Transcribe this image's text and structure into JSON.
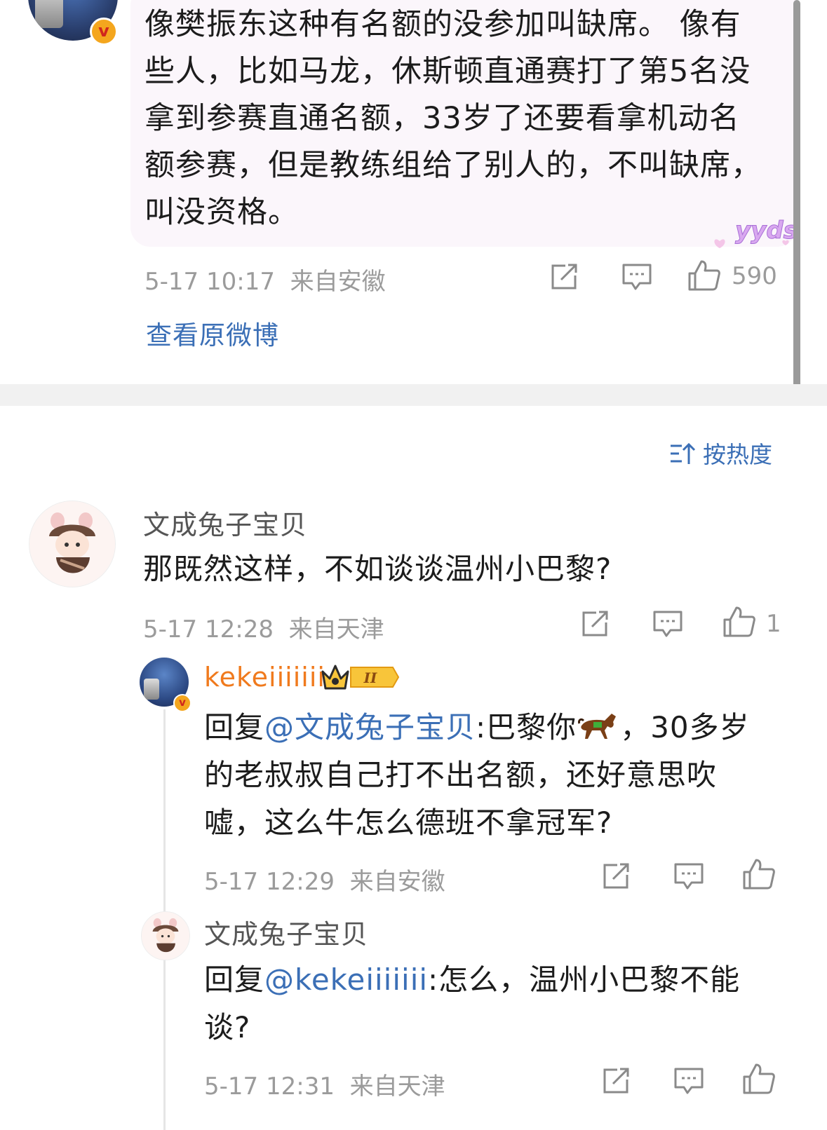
{
  "quoted_post": {
    "text": "像樊振东这种有名额的没参加叫缺席。 像有些人，比如马龙，休斯顿直通赛打了第5名没拿到参赛直通名额，33岁了还要看拿机动名额参赛，但是教练组给了别人的，不叫缺席，叫没资格。",
    "time": "5-17 10:17",
    "location": "来自安徽",
    "like_count": "590",
    "sticker_text": "yyds",
    "view_original_label": "查看原微博"
  },
  "sort": {
    "icon": "sort-icon",
    "label": "按热度"
  },
  "comments": [
    {
      "username": "文成兔子宝贝",
      "text": "那既然这样，不如谈谈温州小巴黎?",
      "time": "5-17 12:28",
      "location": "来自天津",
      "like_count": "1"
    }
  ],
  "replies": [
    {
      "username": "kekeiiiiiii",
      "badge_level": "II",
      "prefix": "回复",
      "mention": "@文成兔子宝贝",
      "text_before_emoji": ":巴黎你",
      "emoji": "horse-emoji",
      "text_after_emoji": "，30多岁的老叔叔自己打不出名额，还好意思吹嘘，这么牛怎么德班不拿冠军?",
      "time": "5-17 12:29",
      "location": "来自安徽"
    },
    {
      "username": "文成兔子宝贝",
      "prefix": "回复",
      "mention": "@kekeiiiiiii",
      "text": ":怎么，温州小巴黎不能谈?",
      "time": "5-17 12:31",
      "location": "来自天津"
    }
  ],
  "colors": {
    "link_blue": "#3b6fb6",
    "username_orange": "#f07a1d",
    "meta_grey": "#9b9b9b",
    "quote_bg": "#fbf6fb"
  }
}
